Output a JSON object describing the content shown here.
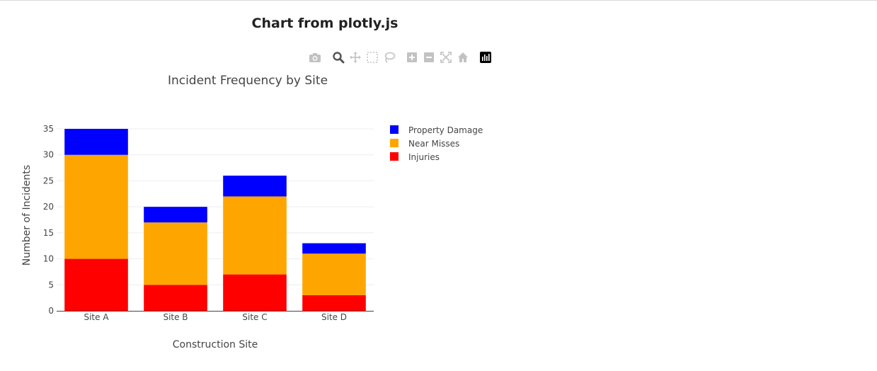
{
  "page": {
    "heading": "Chart from plotly.js"
  },
  "modebar": {
    "buttons": [
      {
        "icon": "camera-icon",
        "title": "Download plot as a png"
      },
      {
        "icon": "zoom-icon",
        "title": "Zoom"
      },
      {
        "icon": "pan-icon",
        "title": "Pan"
      },
      {
        "icon": "box-select-icon",
        "title": "Box Select"
      },
      {
        "icon": "lasso-select-icon",
        "title": "Lasso Select"
      },
      {
        "icon": "zoom-in-icon",
        "title": "Zoom in"
      },
      {
        "icon": "zoom-out-icon",
        "title": "Zoom out"
      },
      {
        "icon": "autoscale-icon",
        "title": "Autoscale"
      },
      {
        "icon": "home-icon",
        "title": "Reset axes"
      },
      {
        "icon": "plotly-logo-icon",
        "title": "Produced with Plotly"
      }
    ]
  },
  "chart_data": {
    "type": "bar",
    "barmode": "stack",
    "title": "Incident Frequency by Site",
    "xlabel": "Construction Site",
    "ylabel": "Number of Incidents",
    "categories": [
      "Site A",
      "Site B",
      "Site C",
      "Site D"
    ],
    "ylim": [
      0,
      35
    ],
    "yticks": [
      0,
      5,
      10,
      15,
      20,
      25,
      30,
      35
    ],
    "grid": true,
    "legend_position": "right",
    "series": [
      {
        "name": "Injuries",
        "color": "#ff0000",
        "values": [
          10,
          5,
          7,
          3
        ]
      },
      {
        "name": "Near Misses",
        "color": "#ffa500",
        "values": [
          20,
          12,
          15,
          8
        ]
      },
      {
        "name": "Property Damage",
        "color": "#0000ff",
        "values": [
          5,
          3,
          4,
          2
        ]
      }
    ]
  }
}
